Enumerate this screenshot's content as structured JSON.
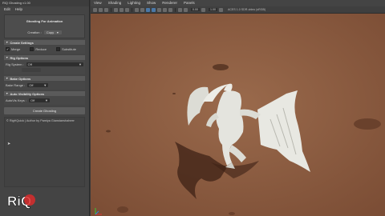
{
  "panel": {
    "window_title": "RiQ Ghosting v1.00",
    "menu": [
      "Edit",
      "Help"
    ],
    "header_title": "Ghosting For Animation",
    "creation_label": "Creation :",
    "creation_value": "Copy",
    "create_settings": {
      "title": "Create Settings",
      "options": [
        {
          "label": "Merge",
          "checked": "✓"
        },
        {
          "label": "Reduce",
          "checked": ""
        },
        {
          "label": "Substitute",
          "checked": ""
        }
      ]
    },
    "rig_options": {
      "title": "Rig Options",
      "rig_system_label": "Rig System :",
      "rig_system_value": "Off"
    },
    "bake_options": {
      "title": "Bake Options",
      "bake_range_label": "Bake Range :",
      "bake_range_value": "Off"
    },
    "auto_visibility": {
      "title": "Auto Visibility Options",
      "auto_keys_label": "AutoVis Keys :",
      "auto_keys_value": "Off"
    },
    "create_button": "Create Ghosting",
    "credits": "© RigHQuick | Author by Pamiya Gianstanshaheer",
    "logo_text": "RiQ"
  },
  "viewport": {
    "menu": [
      "View",
      "Shading",
      "Lighting",
      "Show",
      "Renderer",
      "Panels"
    ],
    "toolbar_value_1": "0.00",
    "toolbar_value_2": "1.00",
    "colorspace_label": "ACES 1.0 SDR-video (sRGB)"
  },
  "colors": {
    "ground": "#8a5a3e",
    "ground_dark": "#6e432c",
    "creature": "#e4e4de",
    "panel_bg": "#444444",
    "logo_red": "#d92b2b"
  },
  "icons": [
    "cursor-icon",
    "caret-down-icon",
    "collapse-arrow-icon",
    "axis-gizmo-icon",
    "checkmark-icon"
  ]
}
